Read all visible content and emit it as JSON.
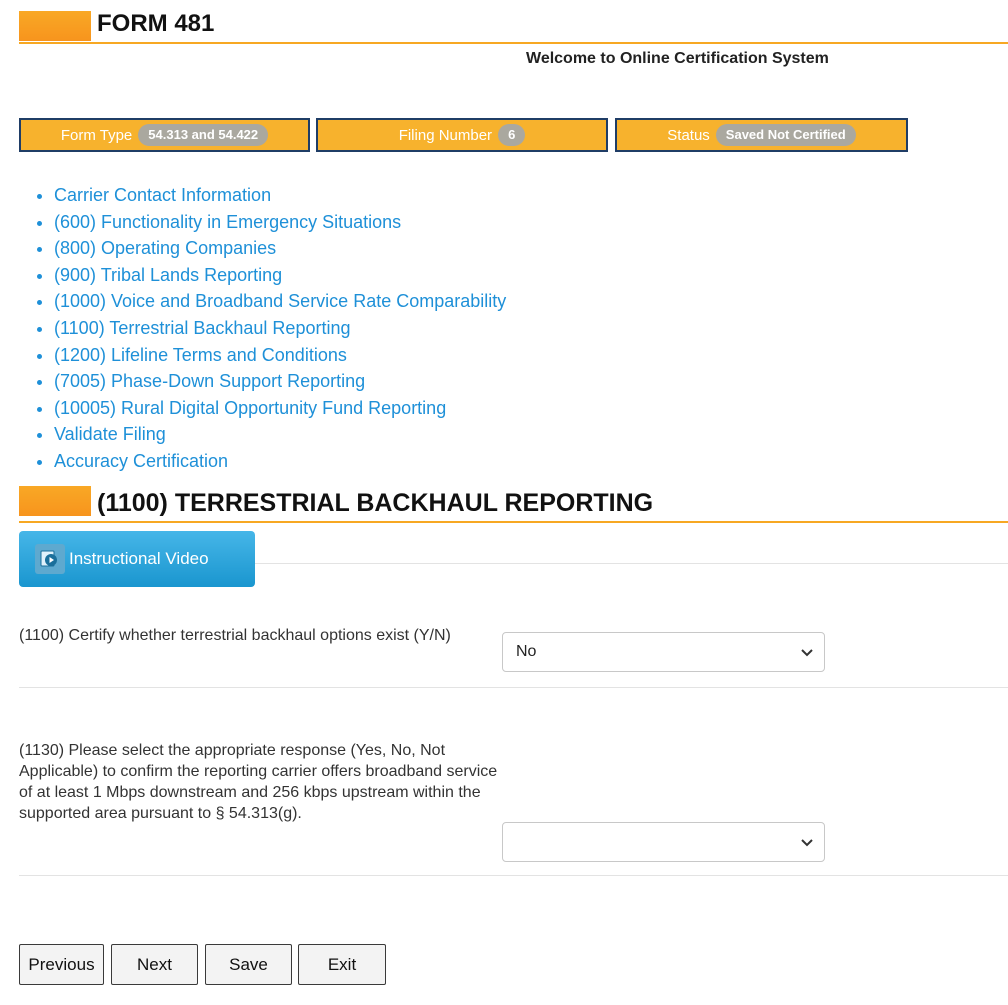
{
  "header": {
    "form_title": "FORM 481",
    "welcome": "Welcome to Online Certification System"
  },
  "status_bar": {
    "form_type_label": "Form Type",
    "form_type_value": "54.313 and 54.422",
    "filing_number_label": "Filing Number",
    "filing_number_value": "6",
    "status_label": "Status",
    "status_value": "Saved Not Certified"
  },
  "nav": {
    "items": [
      "Carrier Contact Information",
      "(600) Functionality in Emergency Situations",
      "(800) Operating Companies",
      "(900) Tribal Lands Reporting",
      "(1000) Voice and Broadband Service Rate Comparability",
      "(1100) Terrestrial Backhaul Reporting",
      "(1200) Lifeline Terms and Conditions",
      "(7005) Phase-Down Support Reporting",
      "(10005) Rural Digital Opportunity Fund Reporting",
      "Validate Filing",
      "Accuracy Certification"
    ]
  },
  "section": {
    "title": "(1100) TERRESTRIAL BACKHAUL REPORTING",
    "video_button": "Instructional Video"
  },
  "questions": {
    "q1": {
      "label": "(1100) Certify whether terrestrial backhaul options exist (Y/N)",
      "value": "No"
    },
    "q2": {
      "label": "(1130) Please select the appropriate response (Yes, No, Not Applicable) to confirm the reporting carrier offers broadband service of at least 1 Mbps downstream and 256 kbps upstream within the supported area pursuant to § 54.313(g).",
      "value": ""
    }
  },
  "buttons": {
    "previous": "Previous",
    "next": "Next",
    "save": "Save",
    "exit": "Exit"
  },
  "colors": {
    "accent": "#f7a823",
    "status_box": "#f7b22d",
    "link": "#1e90d8",
    "video_button": "#2aa5dd"
  }
}
